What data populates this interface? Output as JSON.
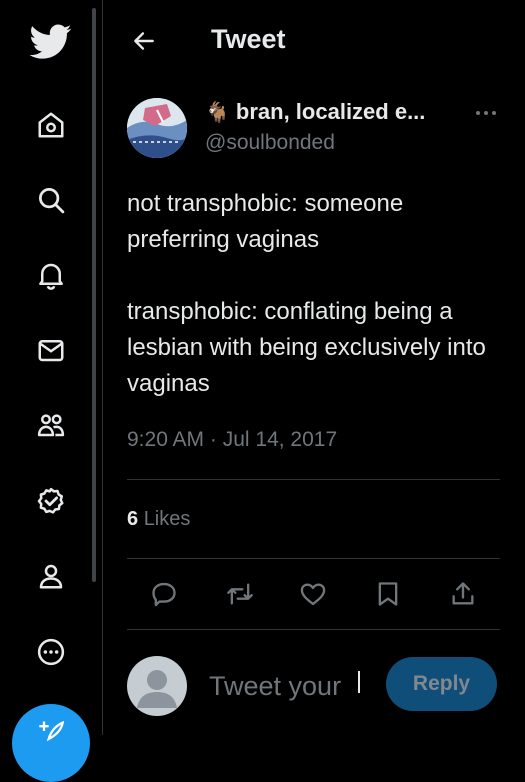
{
  "header": {
    "title": "Tweet"
  },
  "icons": {
    "nav": [
      "twitter-logo",
      "home",
      "search",
      "notifications",
      "messages",
      "communities",
      "verified",
      "profile",
      "more"
    ],
    "actions": [
      "reply",
      "retweet",
      "like",
      "bookmark",
      "share"
    ]
  },
  "colors": {
    "accent": "#1d9bf0",
    "background": "#000000",
    "text": "#e7e9ea",
    "muted": "#71767b",
    "divider": "#2f3336"
  },
  "tweet": {
    "author": {
      "emoji": "🐐",
      "name": "bran, localized e...",
      "handle": "@soulbonded"
    },
    "text": [
      "not transphobic: someone preferring vaginas",
      "transphobic: conflating being a lesbian with being exclusively into vaginas"
    ],
    "timestamp": "9:20 AM · Jul 14, 2017",
    "likes": {
      "count": "6",
      "label": "Likes"
    }
  },
  "reply": {
    "placeholder": "Tweet your",
    "button_label": "Reply"
  }
}
